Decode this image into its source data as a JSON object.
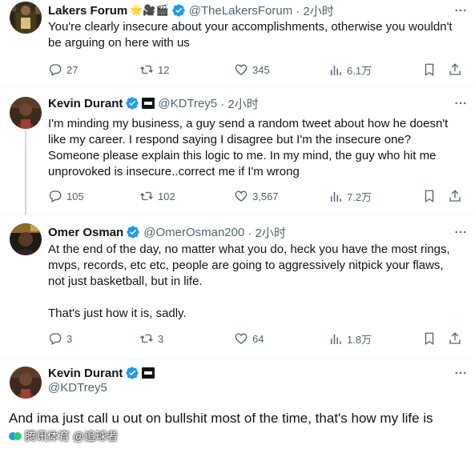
{
  "tweets": [
    {
      "name": "Lakers Forum",
      "handle": "@TheLakersForum",
      "time": "· 2小时",
      "name_emoji": "🌟🎥🎬",
      "text": "You're clearly insecure about your accomplishments, otherwise you wouldn't be arguing on here with us",
      "replies": "27",
      "retweets": "12",
      "likes": "345",
      "views": "6.1万"
    },
    {
      "name": "Kevin Durant",
      "handle": "@KDTrey5",
      "time": "· 2小时",
      "text": "I'm minding my business, a guy send a random tweet about how he doesn't like my career. I respond saying I disagree but I'm the insecure one? Someone please explain this logic to me. In my mind, the guy who hit me unprovoked is insecure..correct me if I'm wrong",
      "replies": "105",
      "retweets": "102",
      "likes": "3,567",
      "views": "7.2万"
    },
    {
      "name": "Omer Osman",
      "handle": "@OmerOsman200",
      "time": "· 2小时",
      "text": "At the end of the day, no matter what you do, heck you have the most rings, mvps, records, etc etc, people are going to aggressively nitpick your flaws, not just basketball, but in life.\n\nThat's just how it is, sadly.",
      "replies": "3",
      "retweets": "3",
      "likes": "64",
      "views": "1.8万"
    },
    {
      "name": "Kevin Durant",
      "handle": "@KDTrey5",
      "text": "And ima just call u out on bullshit most of the time, that's how my life is"
    }
  ],
  "watermark": "腾讯体育 @追球者",
  "colors": {
    "verified": "#1d9bf0",
    "icon_gray": "#536471",
    "text": "#0f1419",
    "divider": "#eff3f4"
  }
}
